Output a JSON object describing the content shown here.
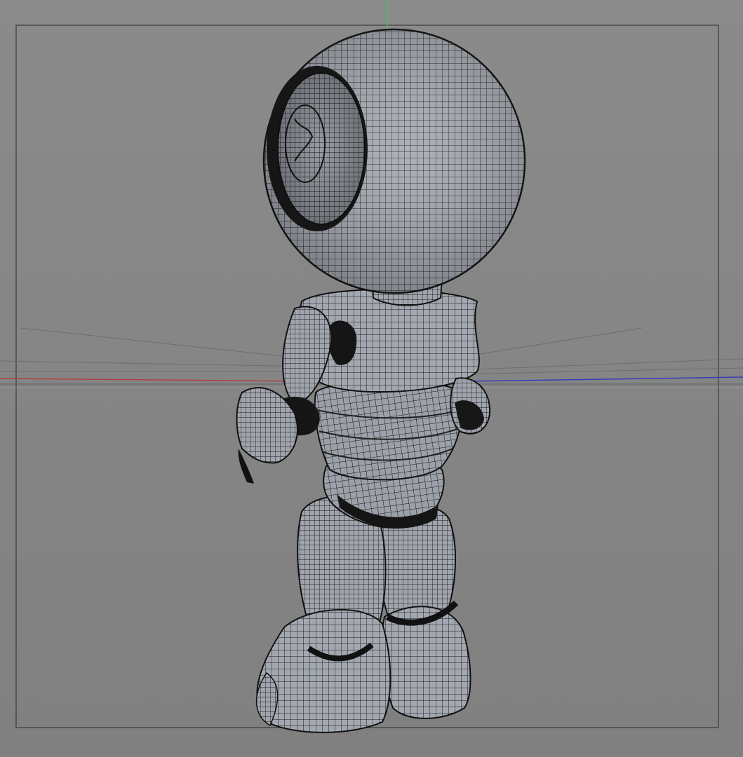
{
  "viewport": {
    "background_color": "#878787",
    "safe_frame_color": "#3a3a3a",
    "axis_colors": {
      "x_axis": "#b04040",
      "y_axis": "#4cbf4c",
      "z_axis": "#3c3cb8"
    },
    "display_mode": "wireframe-shaded",
    "object": {
      "icon": "robot-model-icon",
      "surface_color": "#9ea3ab",
      "wire_color": "#1a1a1a",
      "shadow_color": "#1b1b1b"
    }
  }
}
